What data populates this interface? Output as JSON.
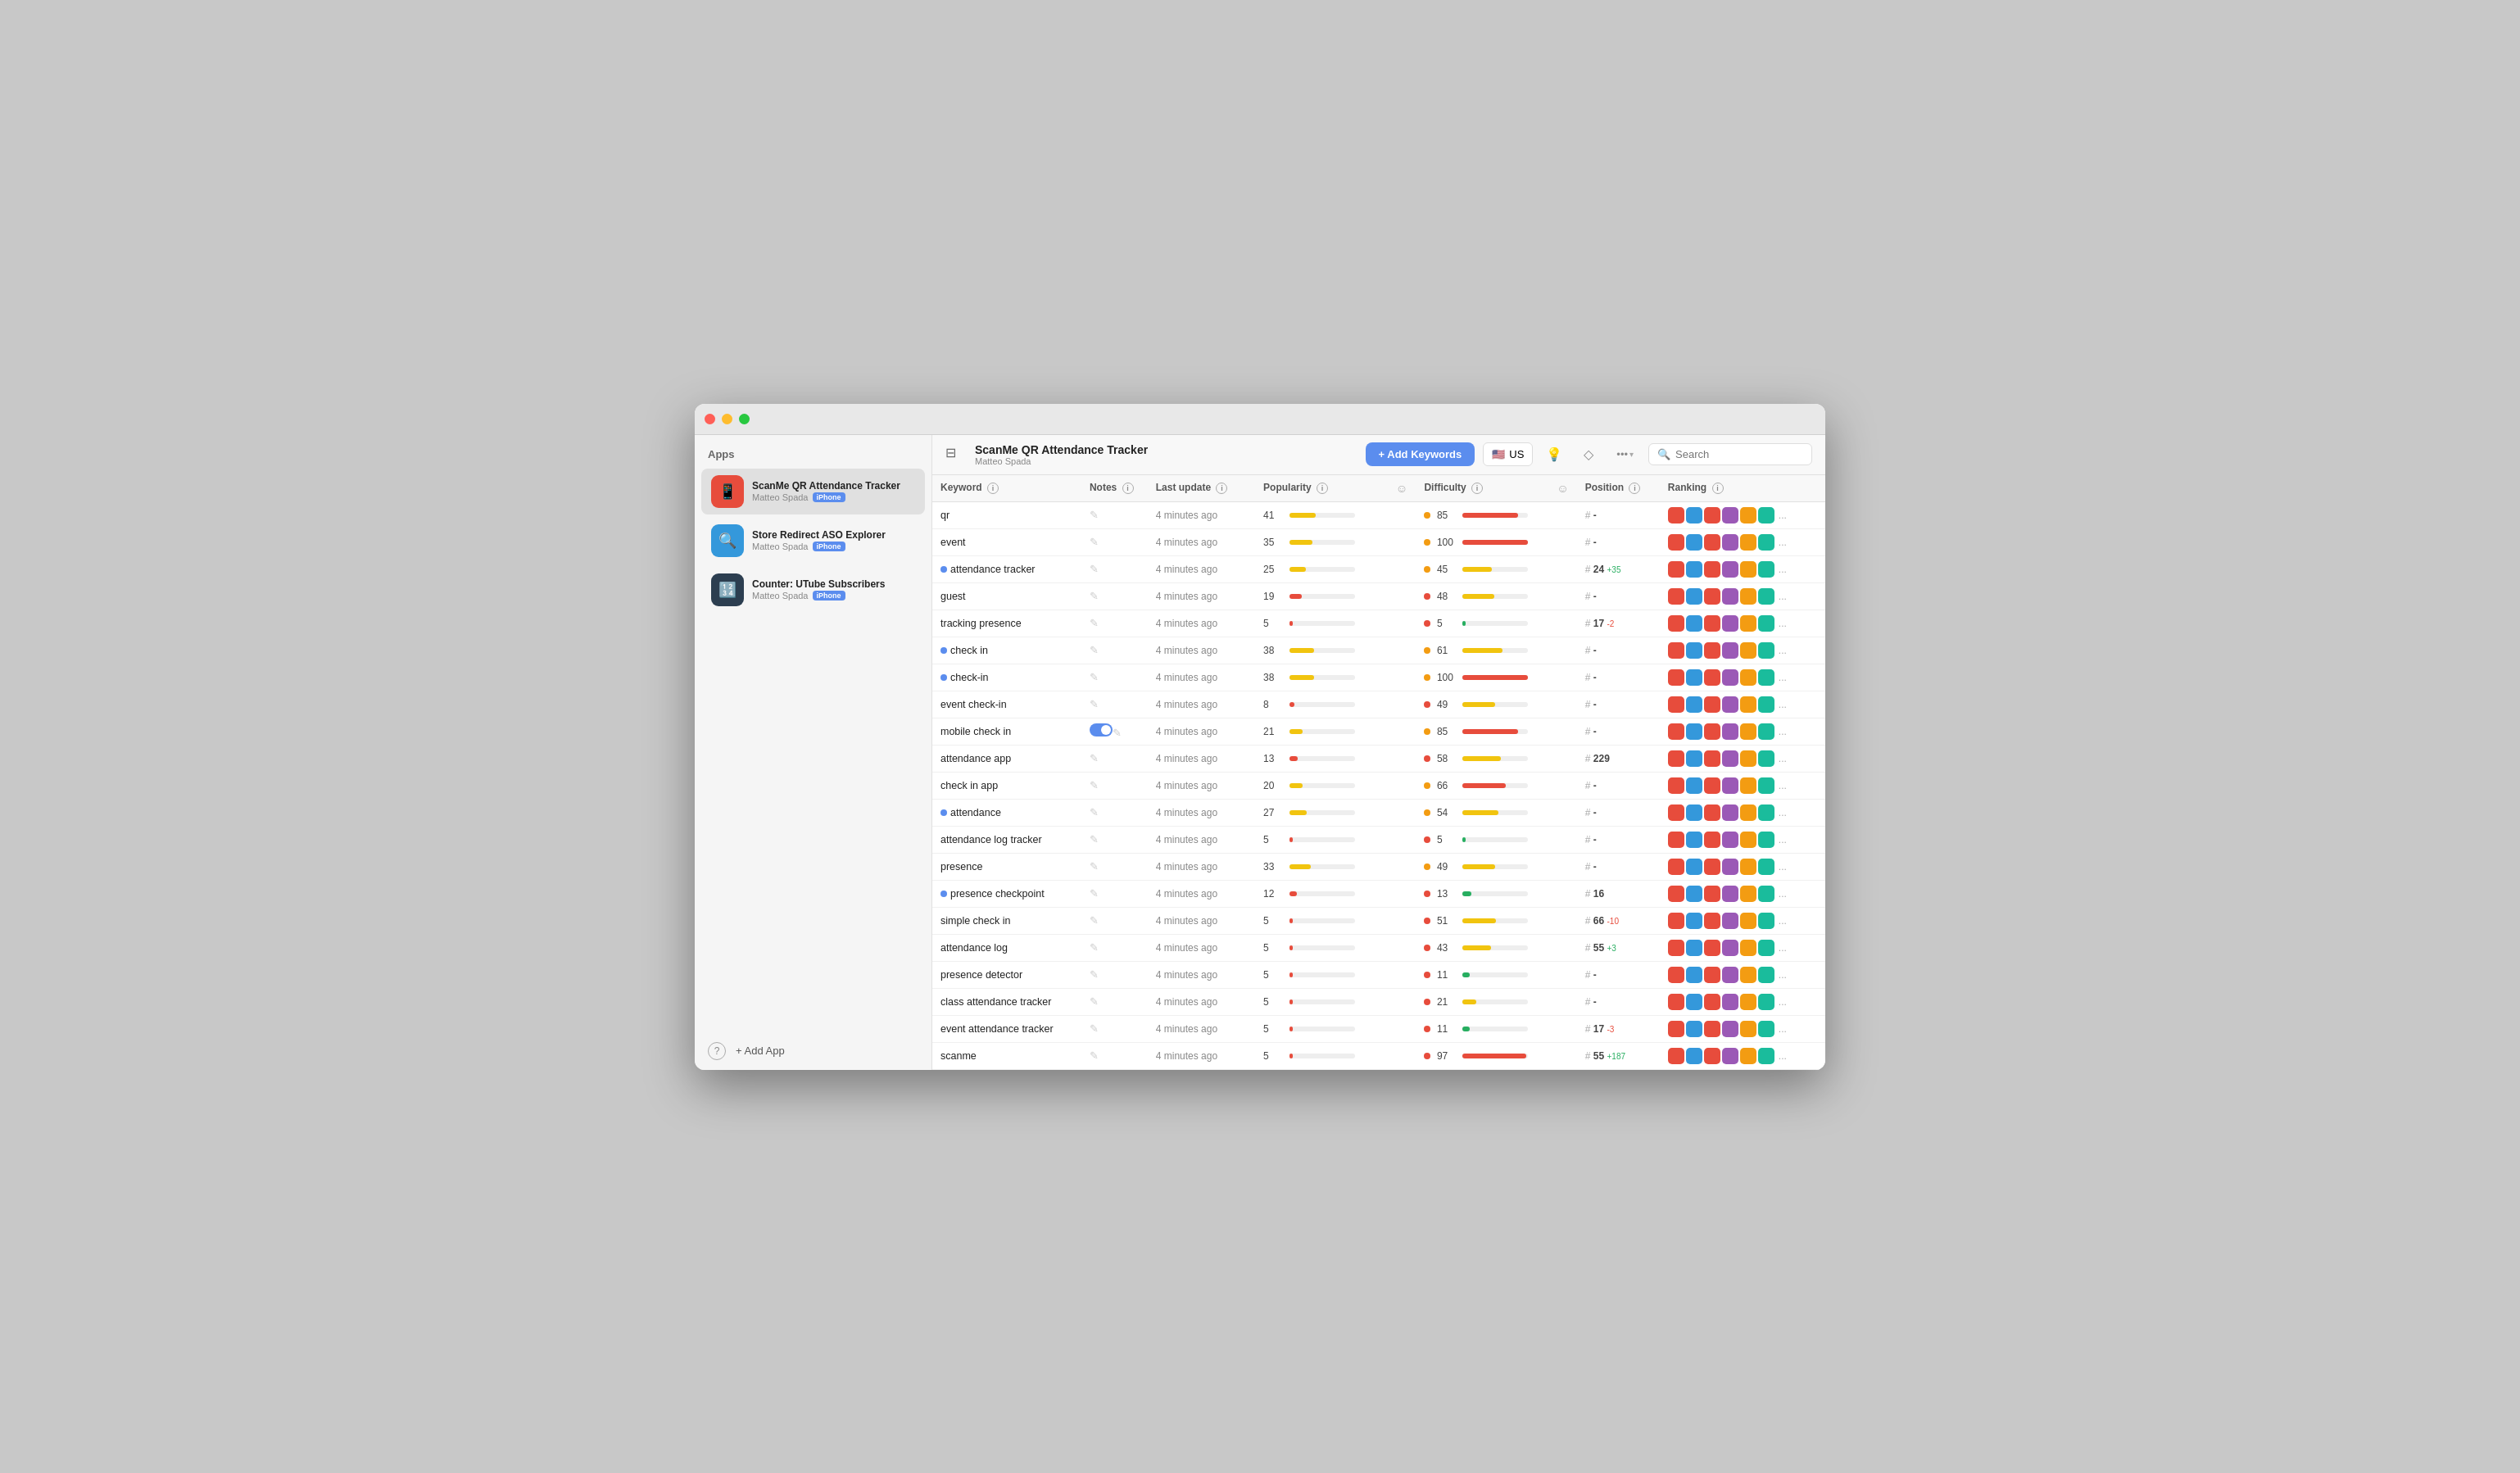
{
  "window": {
    "title": "ScanMe QR Attendance Tracker"
  },
  "sidebar": {
    "header": "Apps",
    "apps": [
      {
        "name": "ScanMe QR Attendance Tracker",
        "author": "Matteo Spada",
        "platform": "iPhone",
        "icon": "📱",
        "active": true,
        "color": "#e74c3c"
      },
      {
        "name": "Store Redirect ASO Explorer",
        "author": "Matteo Spada",
        "platform": "iPhone",
        "icon": "🔍",
        "active": false,
        "color": "#3498db"
      },
      {
        "name": "Counter: UTube Subscribers",
        "author": "Matteo Spada",
        "platform": "iPhone",
        "icon": "🔢",
        "active": false,
        "color": "#2c3e50"
      }
    ],
    "add_app": "+ Add App",
    "help_icon": "?"
  },
  "header": {
    "app_title": "ScanMe QR Attendance Tracker",
    "app_subtitle": "Matteo Spada",
    "add_keywords": "+ Add Keywords",
    "country": "US",
    "search_placeholder": "Search"
  },
  "table": {
    "columns": [
      "Keyword",
      "Notes",
      "Last update",
      "Popularity",
      "",
      "Difficulty",
      "",
      "Position",
      "Ranking"
    ],
    "rows": [
      {
        "keyword": "qr",
        "has_note": false,
        "blue_dot": false,
        "toggle": false,
        "last_update": "4 minutes ago",
        "popularity": 41,
        "pop_color": "yellow",
        "difficulty": 85,
        "diff_color": "red",
        "position": "-",
        "rank_num": null,
        "rank_change": null
      },
      {
        "keyword": "event",
        "has_note": false,
        "blue_dot": false,
        "toggle": false,
        "last_update": "4 minutes ago",
        "popularity": 35,
        "pop_color": "yellow",
        "difficulty": 100,
        "diff_color": "red",
        "position": "-",
        "rank_num": null,
        "rank_change": null
      },
      {
        "keyword": "attendance tracker",
        "has_note": true,
        "blue_dot": true,
        "toggle": false,
        "last_update": "4 minutes ago",
        "popularity": 25,
        "pop_color": "yellow",
        "difficulty": 45,
        "diff_color": "yellow",
        "position": "24",
        "rank_num": 24,
        "rank_change": "+35",
        "rank_up": true
      },
      {
        "keyword": "guest",
        "has_note": false,
        "blue_dot": false,
        "toggle": false,
        "last_update": "4 minutes ago",
        "popularity": 19,
        "pop_color": "red",
        "difficulty": 48,
        "diff_color": "yellow",
        "position": "-",
        "rank_num": null,
        "rank_change": null
      },
      {
        "keyword": "tracking presence",
        "has_note": false,
        "blue_dot": false,
        "toggle": false,
        "last_update": "4 minutes ago",
        "popularity": 5,
        "pop_color": "red",
        "difficulty": 5,
        "diff_color": "green",
        "position": "17",
        "rank_num": 17,
        "rank_change": "-2",
        "rank_up": false
      },
      {
        "keyword": "check in",
        "has_note": true,
        "blue_dot": true,
        "toggle": false,
        "last_update": "4 minutes ago",
        "popularity": 38,
        "pop_color": "yellow",
        "difficulty": 61,
        "diff_color": "yellow",
        "position": "-",
        "rank_num": null,
        "rank_change": null
      },
      {
        "keyword": "check-in",
        "has_note": true,
        "blue_dot": true,
        "toggle": false,
        "last_update": "4 minutes ago",
        "popularity": 38,
        "pop_color": "yellow",
        "difficulty": 100,
        "diff_color": "red",
        "position": "-",
        "rank_num": null,
        "rank_change": null
      },
      {
        "keyword": "event check-in",
        "has_note": false,
        "blue_dot": false,
        "toggle": false,
        "last_update": "4 minutes ago",
        "popularity": 8,
        "pop_color": "red",
        "difficulty": 49,
        "diff_color": "yellow",
        "position": "-",
        "rank_num": null,
        "rank_change": null
      },
      {
        "keyword": "mobile check in",
        "has_note": false,
        "blue_dot": false,
        "toggle": true,
        "last_update": "4 minutes ago",
        "popularity": 21,
        "pop_color": "yellow",
        "difficulty": 85,
        "diff_color": "red",
        "position": "-",
        "rank_num": null,
        "rank_change": null
      },
      {
        "keyword": "attendance app",
        "has_note": false,
        "blue_dot": false,
        "toggle": false,
        "last_update": "4 minutes ago",
        "popularity": 13,
        "pop_color": "red",
        "difficulty": 58,
        "diff_color": "yellow",
        "position": "229",
        "rank_num": 229,
        "rank_change": null
      },
      {
        "keyword": "check in app",
        "has_note": false,
        "blue_dot": false,
        "toggle": false,
        "last_update": "4 minutes ago",
        "popularity": 20,
        "pop_color": "yellow",
        "difficulty": 66,
        "diff_color": "red",
        "position": "-",
        "rank_num": null,
        "rank_change": null
      },
      {
        "keyword": "attendance",
        "has_note": true,
        "blue_dot": true,
        "toggle": false,
        "last_update": "4 minutes ago",
        "popularity": 27,
        "pop_color": "yellow",
        "difficulty": 54,
        "diff_color": "yellow",
        "position": "-",
        "rank_num": null,
        "rank_change": null
      },
      {
        "keyword": "attendance log tracker",
        "has_note": false,
        "blue_dot": false,
        "toggle": false,
        "last_update": "4 minutes ago",
        "popularity": 5,
        "pop_color": "red",
        "difficulty": 5,
        "diff_color": "green",
        "position": "-",
        "rank_num": null,
        "rank_change": null
      },
      {
        "keyword": "presence",
        "has_note": false,
        "blue_dot": false,
        "toggle": false,
        "last_update": "4 minutes ago",
        "popularity": 33,
        "pop_color": "yellow",
        "difficulty": 49,
        "diff_color": "yellow",
        "position": "-",
        "rank_num": null,
        "rank_change": null
      },
      {
        "keyword": "presence checkpoint",
        "has_note": true,
        "blue_dot": true,
        "toggle": false,
        "last_update": "4 minutes ago",
        "popularity": 12,
        "pop_color": "red",
        "difficulty": 13,
        "diff_color": "green",
        "position": "16",
        "rank_num": 16,
        "rank_change": null
      },
      {
        "keyword": "simple check in",
        "has_note": false,
        "blue_dot": false,
        "toggle": false,
        "last_update": "4 minutes ago",
        "popularity": 5,
        "pop_color": "red",
        "difficulty": 51,
        "diff_color": "yellow",
        "position": "66",
        "rank_num": 66,
        "rank_change": "-10",
        "rank_up": false
      },
      {
        "keyword": "attendance log",
        "has_note": false,
        "blue_dot": false,
        "toggle": false,
        "last_update": "4 minutes ago",
        "popularity": 5,
        "pop_color": "red",
        "difficulty": 43,
        "diff_color": "yellow",
        "position": "55",
        "rank_num": 55,
        "rank_change": "+3",
        "rank_up": true
      },
      {
        "keyword": "presence detector",
        "has_note": false,
        "blue_dot": false,
        "toggle": false,
        "last_update": "4 minutes ago",
        "popularity": 5,
        "pop_color": "red",
        "difficulty": 11,
        "diff_color": "green",
        "position": "-",
        "rank_num": null,
        "rank_change": null
      },
      {
        "keyword": "class attendance tracker",
        "has_note": false,
        "blue_dot": false,
        "toggle": false,
        "last_update": "4 minutes ago",
        "popularity": 5,
        "pop_color": "red",
        "difficulty": 21,
        "diff_color": "yellow",
        "position": "-",
        "rank_num": null,
        "rank_change": null
      },
      {
        "keyword": "event attendance tracker",
        "has_note": false,
        "blue_dot": false,
        "toggle": false,
        "last_update": "4 minutes ago",
        "popularity": 5,
        "pop_color": "red",
        "difficulty": 11,
        "diff_color": "green",
        "position": "17",
        "rank_num": 17,
        "rank_change": "-3",
        "rank_up": false
      },
      {
        "keyword": "scanme",
        "has_note": false,
        "blue_dot": false,
        "toggle": false,
        "last_update": "4 minutes ago",
        "popularity": 5,
        "pop_color": "red",
        "difficulty": 97,
        "diff_color": "red",
        "position": "55",
        "rank_num": 55,
        "rank_change": "+187",
        "rank_up": true
      }
    ]
  },
  "colors": {
    "accent": "#5b8dee",
    "red": "#e74c3c",
    "yellow": "#f1c40f",
    "green": "#27ae60",
    "orange": "#f39c12"
  }
}
